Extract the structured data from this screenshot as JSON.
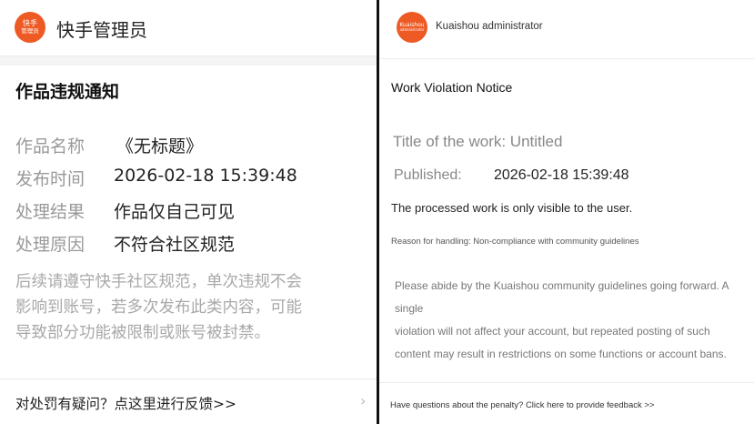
{
  "left": {
    "header": {
      "logo_top": "快手",
      "logo_bottom": "管理员",
      "app_name": "快手管理员"
    },
    "title": "作品违规通知",
    "rows": [
      {
        "label": "作品名称",
        "value": "《无标题》"
      },
      {
        "label": "发布时间",
        "value": "2026-02-18 15:39:48"
      },
      {
        "label": "处理结果",
        "value": "作品仅自己可见"
      },
      {
        "label": "处理原因",
        "value": "不符合社区规范"
      }
    ],
    "body_lines": [
      "后续请遵守快手社区规范，单次违规不会",
      "影响到账号，若多次发布此类内容，可能",
      "导致部分功能被限制或账号被封禁。"
    ],
    "footer": "对处罚有疑问？点这里进行反馈>>",
    "chevron": "›"
  },
  "right": {
    "header": {
      "logo_top": "Kuaishou",
      "logo_bottom": "administrator",
      "app_name": "Kuaishou administrator"
    },
    "title": "Work Violation Notice",
    "work_title": "Title of the work: Untitled",
    "published_label": "Published:",
    "published_value": "2026-02-18 15:39:48",
    "result": "The processed work is only visible to the user.",
    "reason": "Reason for handling: Non-compliance with community guidelines",
    "body_lines": [
      "Please abide by the Kuaishou community guidelines going forward. A single",
      "violation will not affect your account, but repeated posting of such",
      "content may result in restrictions on some functions or account bans."
    ],
    "footer": "Have questions about the penalty? Click here to provide feedback >>"
  },
  "colors": {
    "brand": "#ee5a24",
    "label_gray": "#999999",
    "body_gray": "#a8a8a8",
    "divider": "#111111"
  },
  "icons": {
    "logo": "kuaishou-admin-logo",
    "chevron": "chevron-right-icon"
  }
}
